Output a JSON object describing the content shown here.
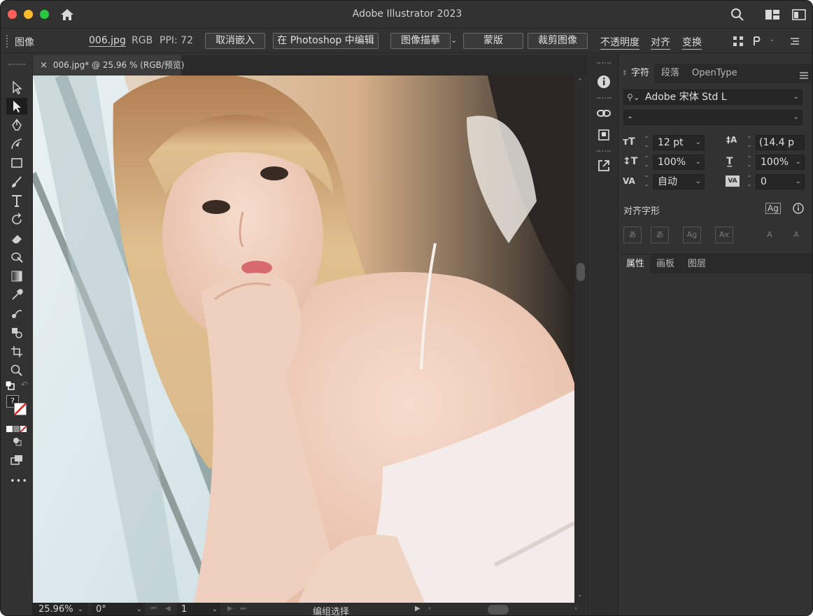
{
  "window": {
    "title": "Adobe Illustrator 2023"
  },
  "control_bar": {
    "object_type": "图像",
    "filename": "006.jpg",
    "color_mode": "RGB",
    "ppi": "PPI: 72",
    "unembed_button": "取消嵌入",
    "edit_in_photoshop_button": "在 Photoshop 中编辑",
    "image_trace_button": "图像描摹",
    "mask_button": "蒙版",
    "crop_image_button": "裁剪图像",
    "opacity_label": "不透明度",
    "align_label": "对齐",
    "transform_label": "变换"
  },
  "document_tab": {
    "label": "006.jpg* @ 25.96 % (RGB/预览)",
    "close": "×"
  },
  "status_bar": {
    "zoom": "25.96%",
    "rotation": "0°",
    "artboard": "1",
    "mode": "编组选择"
  },
  "toolbar": {
    "fill_unknown": "?",
    "more": "•••"
  },
  "character_panel": {
    "tabs": [
      "字符",
      "段落",
      "OpenType"
    ],
    "font_family": "Adobe 宋体 Std L",
    "font_style": "-",
    "font_size": "12 pt",
    "leading": "(14.4 p",
    "vertical_scale": "100%",
    "horizontal_scale": "100%",
    "kerning": "自动",
    "tracking": "0",
    "align_glyphs_label": "对齐字形",
    "glyph_buttons": [
      "あ",
      "あ",
      "Ag",
      "Ax",
      "A",
      "A"
    ]
  },
  "bottom_panel": {
    "tabs": [
      "属性",
      "画板",
      "图层"
    ]
  },
  "colors": {
    "bg": "#323232",
    "canvas_bg": "#2a2a2a",
    "close": "#ff5f57",
    "minimize": "#febc2e",
    "zoom": "#28c840"
  }
}
